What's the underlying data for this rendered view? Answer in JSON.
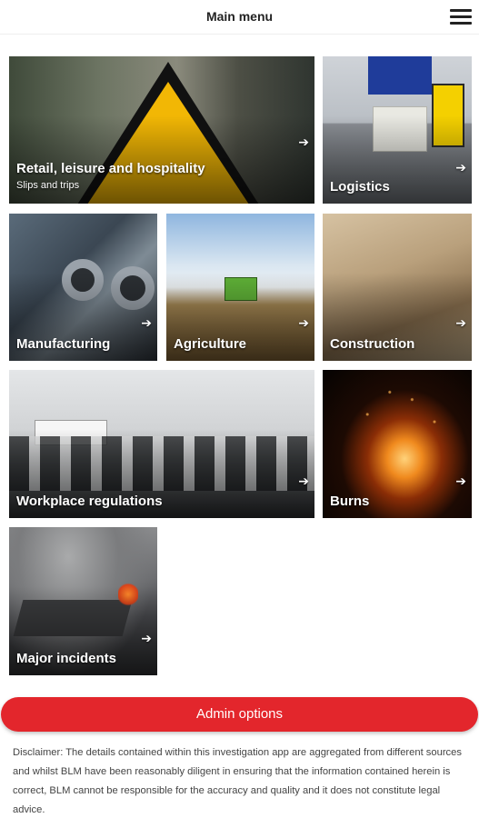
{
  "header": {
    "title": "Main menu",
    "menu_icon": "hamburger-menu-icon"
  },
  "tiles": [
    {
      "id": "retail",
      "label": "Retail, leisure and hospitality",
      "subtitle": "Slips and trips",
      "arrow": "➔"
    },
    {
      "id": "logistics",
      "label": "Logistics",
      "arrow": "➔"
    },
    {
      "id": "manufacturing",
      "label": "Manufacturing",
      "arrow": "➔"
    },
    {
      "id": "agriculture",
      "label": "Agriculture",
      "arrow": "➔"
    },
    {
      "id": "construction",
      "label": "Construction",
      "arrow": "➔"
    },
    {
      "id": "workplace",
      "label": "Workplace regulations",
      "arrow": "➔"
    },
    {
      "id": "burns",
      "label": "Burns",
      "arrow": "➔"
    },
    {
      "id": "incidents",
      "label": "Major incidents",
      "arrow": "➔"
    }
  ],
  "admin": {
    "label": "Admin options",
    "color": "#e3262c"
  },
  "disclaimer": "Disclaimer: The details contained within this investigation app are aggregated from different sources and whilst BLM have been reasonably diligent in ensuring that the information contained herein is correct, BLM cannot be responsible for the accuracy and quality and it does not constitute legal advice."
}
